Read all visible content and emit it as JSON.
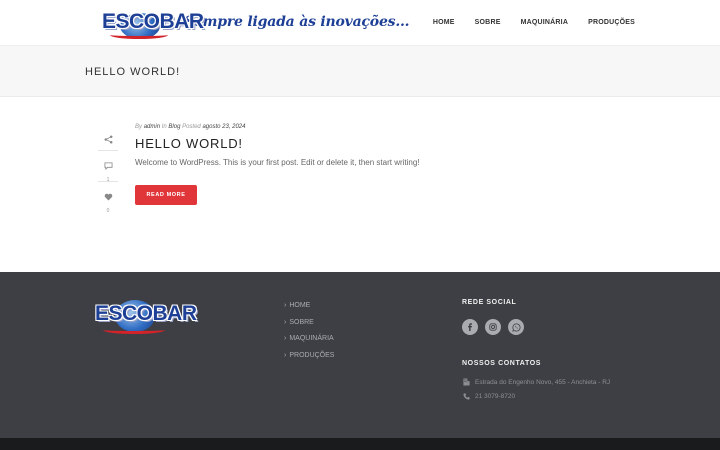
{
  "header": {
    "logo_text": "ESCOBAR",
    "slogan": "Sempre ligada às inovações...",
    "nav": [
      {
        "label": "HOME"
      },
      {
        "label": "SOBRE"
      },
      {
        "label": "MAQUINÁRIA"
      },
      {
        "label": "PRODUÇÕES"
      }
    ]
  },
  "title_bar": {
    "title": "HELLO WORLD!"
  },
  "post": {
    "meta": {
      "by_label": "By",
      "author": "admin",
      "in_label": "In",
      "category": "Blog",
      "posted_label": "Posted",
      "date": "agosto 23, 2024"
    },
    "title": "HELLO WORLD!",
    "excerpt": "Welcome to WordPress. This is your first post. Edit or delete it, then start writing!",
    "comments_count": "1",
    "likes_count": "0",
    "read_more_label": "READ MORE"
  },
  "footer": {
    "logo_text": "ESCOBAR",
    "links": [
      {
        "label": "HOME"
      },
      {
        "label": "SOBRE"
      },
      {
        "label": "MAQUINÁRIA"
      },
      {
        "label": "PRODUÇÕES"
      }
    ],
    "social_heading": "REDE SOCIAL",
    "social_icons": [
      "facebook-icon",
      "instagram-icon",
      "whatsapp-icon"
    ],
    "contacts_heading": "NOSSOS CONTATOS",
    "address": "Estrada do Engenho Novo, 455 - Anchieta - RJ",
    "phone": "21 3079-8720"
  },
  "colors": {
    "brand_blue": "#1d3f95",
    "accent_red": "#e0363a",
    "footer_bg": "#3d3f44",
    "title_bar_bg": "#f7f7f7"
  }
}
